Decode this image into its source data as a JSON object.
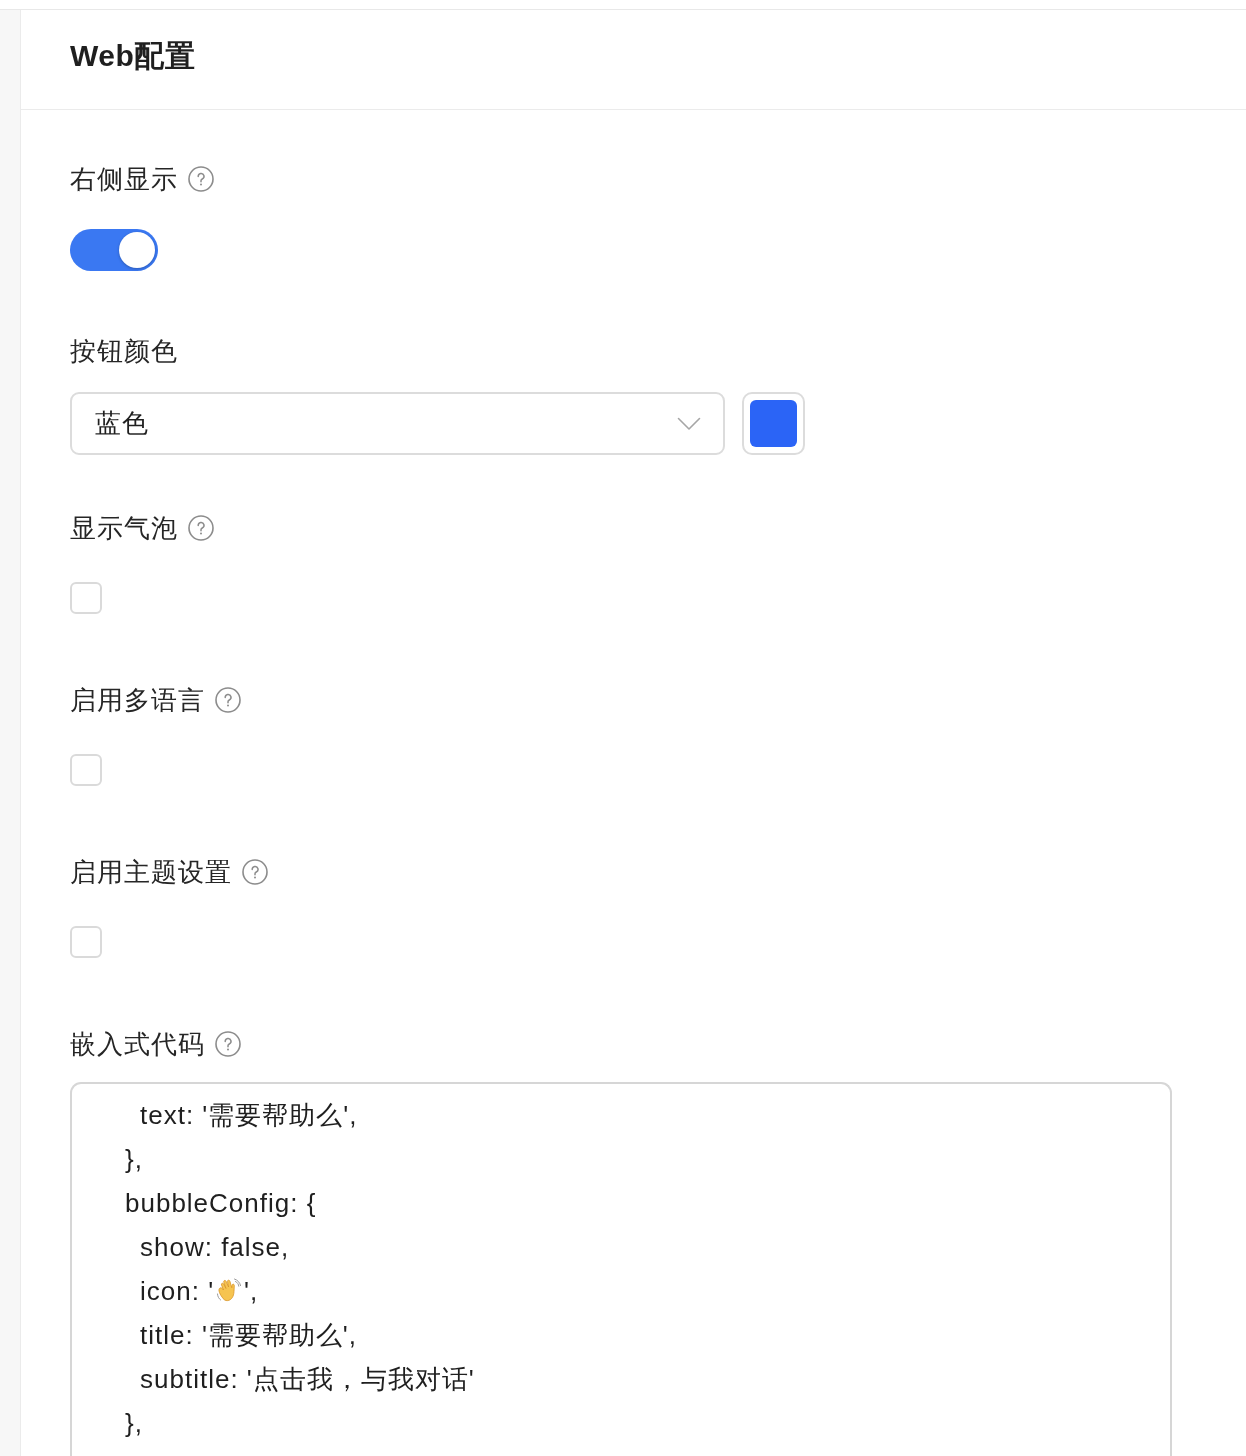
{
  "page": {
    "title": "Web配置"
  },
  "fields": [
    {
      "kind": "switch",
      "label": "右侧显示",
      "help": true,
      "on": true
    },
    {
      "kind": "select",
      "label": "按钮颜色",
      "help": false,
      "value": "蓝色",
      "color": "#2b64f6"
    },
    {
      "kind": "checkbox",
      "label": "显示气泡",
      "help": true,
      "checked": false
    },
    {
      "kind": "checkbox",
      "label": "启用多语言",
      "help": true,
      "checked": false
    },
    {
      "kind": "checkbox",
      "label": "启用主题设置",
      "help": true,
      "checked": false
    },
    {
      "kind": "code",
      "label": "嵌入式代码",
      "help": true,
      "lines": [
        {
          "kind": "text",
          "children": [
            {
              "kind": "text",
              "text": "text: '需要帮助么',"
            }
          ]
        },
        {
          "kind": "text",
          "text": "},"
        },
        {
          "kind": "text",
          "text": "bubbleConfig: {",
          "children": [
            {
              "kind": "text",
              "text": "show: false,"
            },
            {
              "kind": "emoji",
              "before": "icon: '",
              "after": "',"
            },
            {
              "kind": "text",
              "text": "title: '需要帮助么',"
            },
            {
              "kind": "text",
              "text": "subtitle: '点击我，与我对话'"
            }
          ]
        },
        {
          "kind": "text",
          "text": "},"
        }
      ]
    }
  ]
}
